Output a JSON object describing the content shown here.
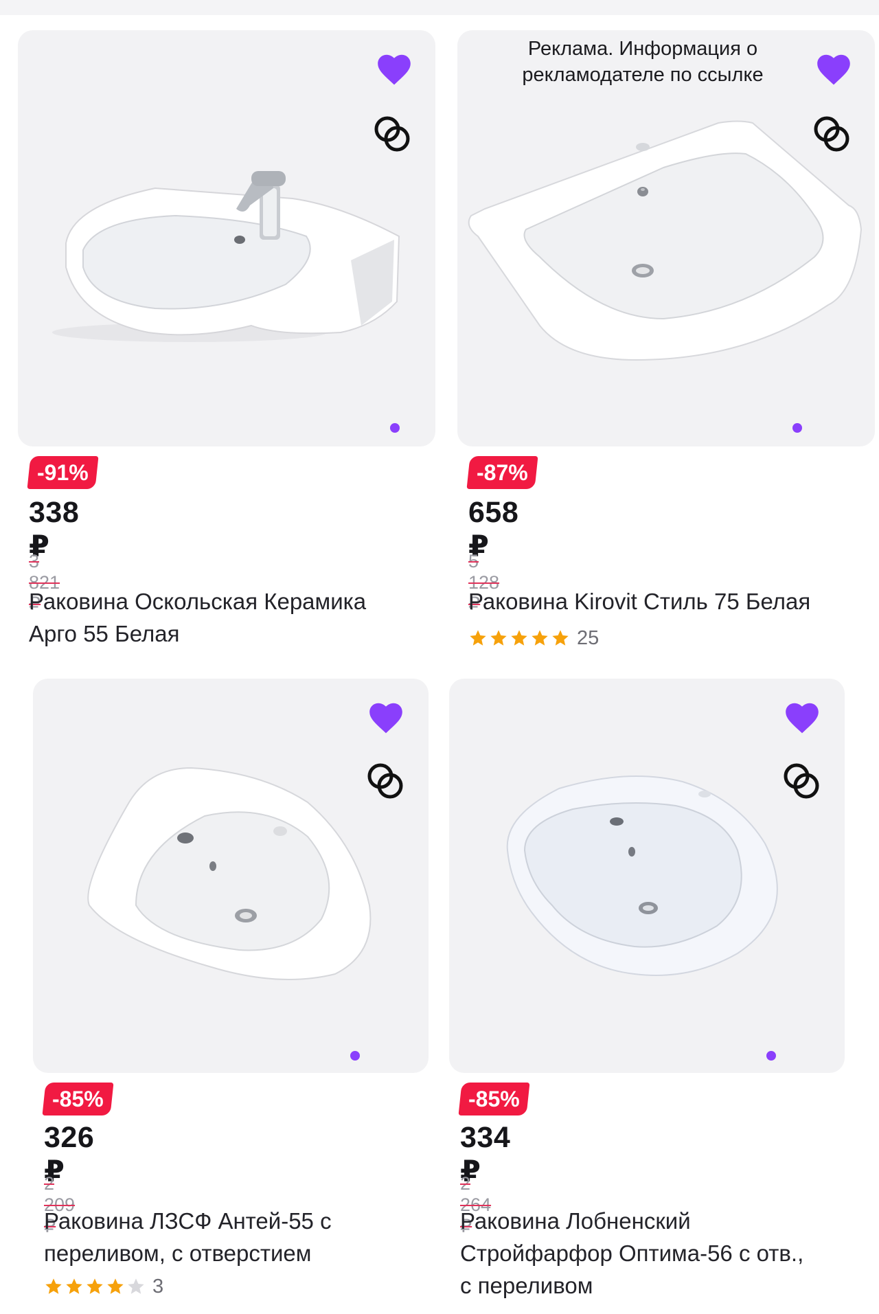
{
  "colors": {
    "accent": "#8a3ffc",
    "discount": "#f11a42",
    "star": "#f6a10b",
    "star_empty": "#d8d8dc"
  },
  "icons": {
    "favorite": "heart-icon",
    "compare": "compare-rings-icon",
    "rating": "star-icon"
  },
  "ad_label": "Реклама. Информация о рекламодателе по ссылке",
  "products": [
    {
      "discount": "-91%",
      "price": "338 ₽",
      "old_price": "3 821 ₽",
      "title_line1": "Раковина Оскольская Керамика",
      "title_line2": "Арго 55 Белая"
    },
    {
      "discount": "-87%",
      "price": "658 ₽",
      "old_price": "5 128 ₽",
      "title_line1": "Раковина Kirovit Стиль 75 Белая",
      "rating": 5,
      "rating_count": "25"
    },
    {
      "discount": "-85%",
      "price": "326 ₽",
      "old_price": "2 209 ₽",
      "title_line1": "Раковина ЛЗСФ Антей-55 с",
      "title_line2": "переливом, с отверстием",
      "rating": 4,
      "rating_count": "3"
    },
    {
      "discount": "-85%",
      "price": "334 ₽",
      "old_price": "2 264 ₽",
      "title_line1": "Раковина Лобненский",
      "title_line2": "Стройфарфор Оптима-56 с отв.,",
      "title_line3": "с переливом"
    }
  ]
}
